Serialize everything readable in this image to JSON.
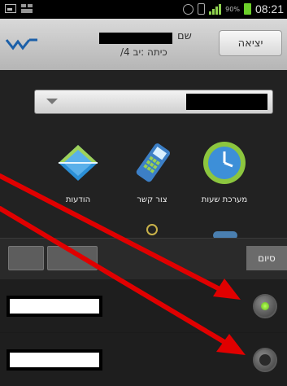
{
  "status_bar": {
    "battery_percent": "90%",
    "time": "08:21",
    "icons": [
      "gallery-icon",
      "grid-icon",
      "alarm-icon",
      "vibrate-icon",
      "signal-icon",
      "battery-icon"
    ]
  },
  "header": {
    "name_label": "שם",
    "class_label": "כיתה :יב 4/",
    "logout_label": "יציאה",
    "brand_color": "#1b5fa8"
  },
  "tiles": [
    {
      "label": "הודעות",
      "icon": "envelope-icon"
    },
    {
      "label": "צור קשר",
      "icon": "phone-icon"
    },
    {
      "label": "מערכת שעות",
      "icon": "clock-icon"
    }
  ],
  "toolbar": {
    "end_label": "סיום"
  },
  "list": {
    "items": [
      {
        "selected": true
      },
      {
        "selected": false
      }
    ]
  },
  "annotation_color": "#e00000"
}
